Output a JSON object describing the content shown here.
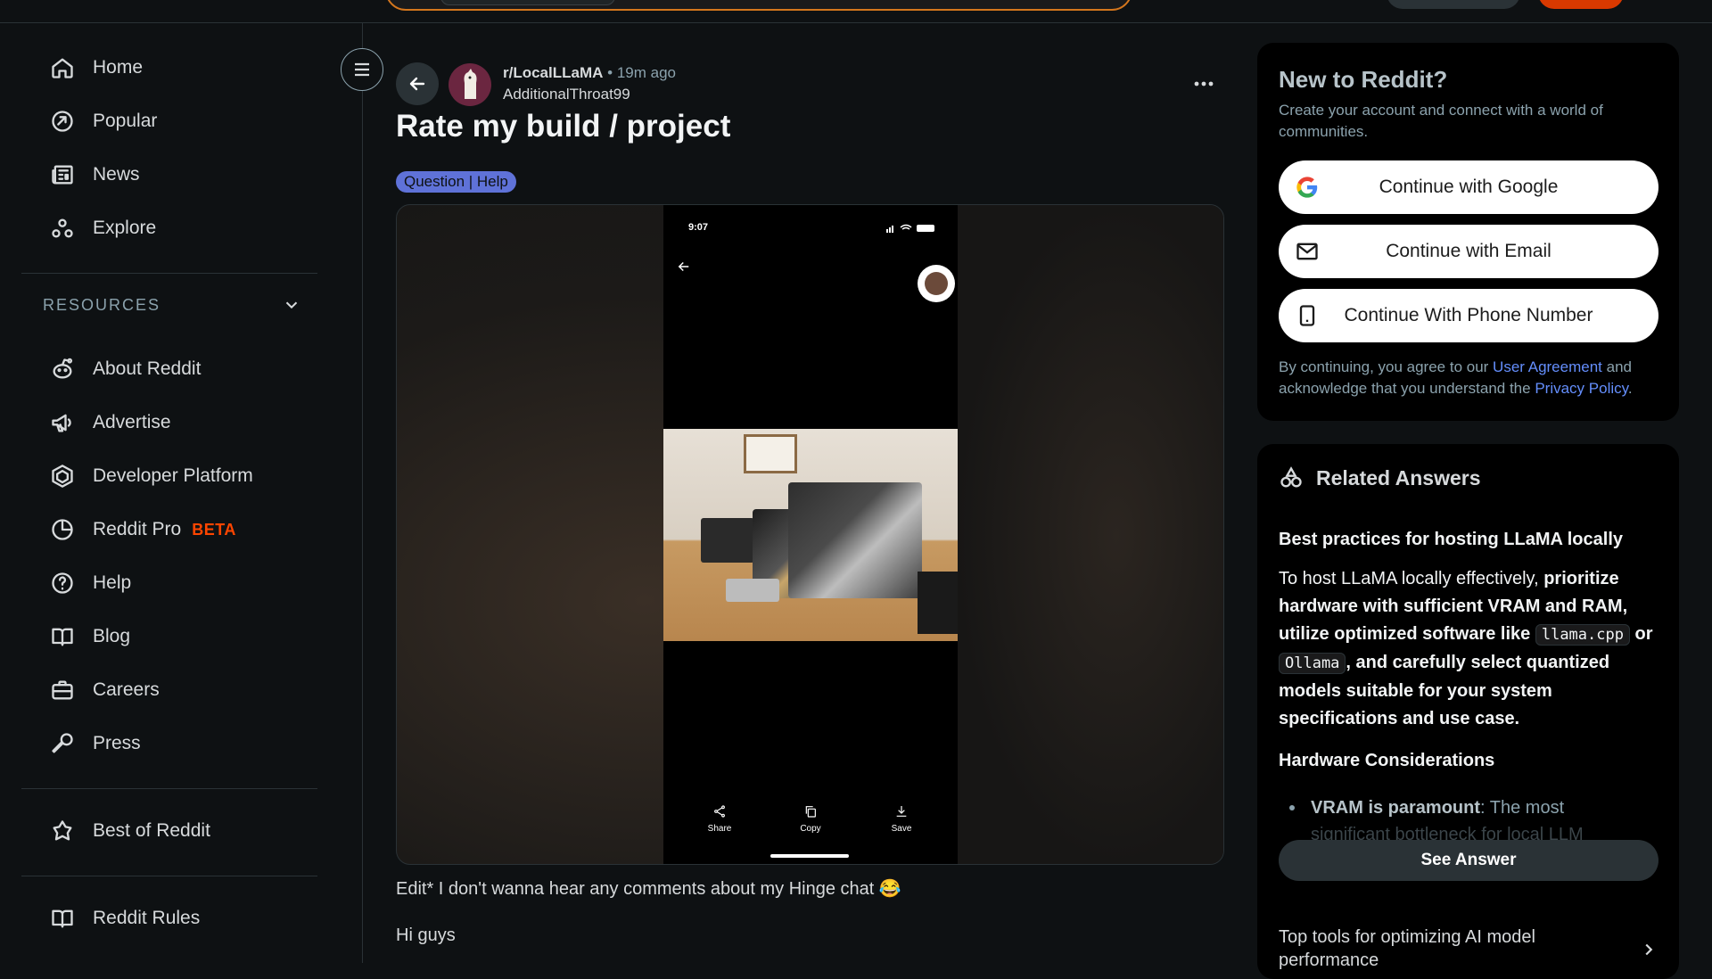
{
  "sidebar": {
    "nav": [
      {
        "label": "Home",
        "icon": "home-icon"
      },
      {
        "label": "Popular",
        "icon": "popular-icon"
      },
      {
        "label": "News",
        "icon": "news-icon"
      },
      {
        "label": "Explore",
        "icon": "explore-icon"
      }
    ],
    "resources_heading": "RESOURCES",
    "resources": [
      {
        "label": "About Reddit",
        "icon": "reddit-alien-icon"
      },
      {
        "label": "Advertise",
        "icon": "megaphone-icon"
      },
      {
        "label": "Developer Platform",
        "icon": "developer-platform-icon"
      },
      {
        "label": "Reddit Pro",
        "icon": "reddit-pro-icon",
        "badge": "BETA"
      },
      {
        "label": "Help",
        "icon": "help-icon"
      },
      {
        "label": "Blog",
        "icon": "blog-icon"
      },
      {
        "label": "Careers",
        "icon": "briefcase-icon"
      },
      {
        "label": "Press",
        "icon": "microphone-icon"
      }
    ],
    "best_of": "Best of Reddit",
    "rules": "Reddit Rules"
  },
  "post": {
    "subreddit": "r/LocalLLaMA",
    "separator": "•",
    "time": "19m ago",
    "author": "AdditionalThroat99",
    "title": "Rate my build / project",
    "flair": "Question | Help",
    "media": {
      "status_time": "9:07",
      "actions": [
        {
          "label": "Share",
          "icon": "share-icon"
        },
        {
          "label": "Copy",
          "icon": "copy-icon"
        },
        {
          "label": "Save",
          "icon": "download-icon"
        }
      ]
    },
    "body_line_1": "Edit* I don't wanna hear any comments about my Hinge chat 😂",
    "body_line_2": "Hi guys"
  },
  "auth_card": {
    "title": "New to Reddit?",
    "description": "Create your account and connect with a world of communities.",
    "google": "Continue with Google",
    "email": "Continue with Email",
    "phone": "Continue With Phone Number",
    "legal_prefix": "By continuing, you agree to our ",
    "user_agreement": "User Agreement",
    "legal_middle": " and acknowledge that you understand the ",
    "privacy_policy": "Privacy Policy",
    "legal_suffix": "."
  },
  "related": {
    "heading": "Related Answers",
    "question": "Best practices for hosting LLaMA locally",
    "answer_intro": "To host LLaMA locally effectively, ",
    "answer_bold_1": "prioritize hardware with sufficient VRAM and RAM, utilize optimized software like ",
    "code_1": "llama.cpp",
    "answer_bold_2": " or ",
    "code_2": "Ollama",
    "answer_bold_3": ", and carefully select quantized models suitable for your system specifications and use case.",
    "subheading": "Hardware Considerations",
    "bullet_bold": "VRAM is paramount",
    "bullet_text": ": The most",
    "bullet_fade": "significant bottleneck for local LLM",
    "see_answer": "See Answer",
    "next_question": "Top tools for optimizing AI model performance"
  },
  "colors": {
    "accent": "#ff4500",
    "flair": "#5f72d8",
    "link": "#648efc",
    "background": "#0e1113"
  }
}
